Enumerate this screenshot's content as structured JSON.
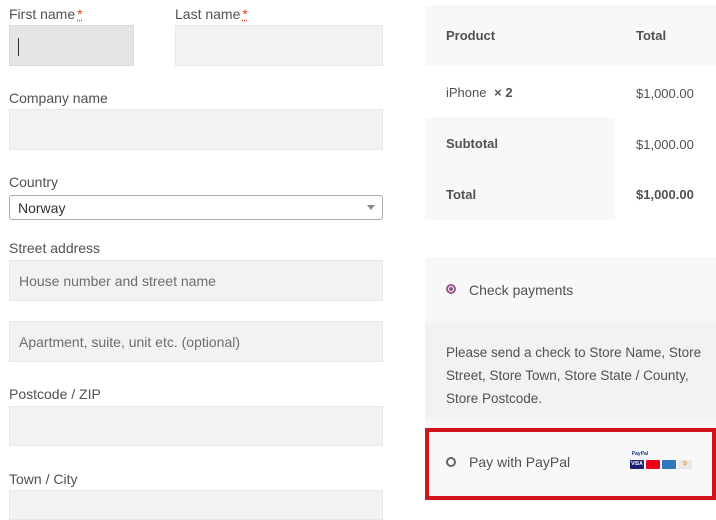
{
  "billing": {
    "first_name_label": "First name",
    "last_name_label": "Last name",
    "required_mark": "*",
    "company_label": "Company name",
    "country_label": "Country",
    "country_value": "Norway",
    "street_label": "Street address",
    "street_placeholder": "House number and street name",
    "street2_placeholder": "Apartment, suite, unit etc. (optional)",
    "postcode_label": "Postcode / ZIP",
    "town_label": "Town / City"
  },
  "order": {
    "header_product": "Product",
    "header_total": "Total",
    "item_name": "iPhone",
    "item_qty": "× 2",
    "item_total": "$1,000.00",
    "subtotal_label": "Subtotal",
    "subtotal_value": "$1,000.00",
    "total_label": "Total",
    "total_value": "$1,000.00"
  },
  "payment": {
    "check_label": "Check payments",
    "check_description": "Please send a check to Store Name, Store Street, Store Town, Store State / County, Store Postcode.",
    "paypal_label": "Pay with PayPal",
    "card_icons": [
      "paypal",
      "visa",
      "mastercard",
      "amex",
      "discover"
    ]
  },
  "colors": {
    "accent": "#96588a",
    "required": "#e2401c",
    "highlight": "#d0141b"
  }
}
